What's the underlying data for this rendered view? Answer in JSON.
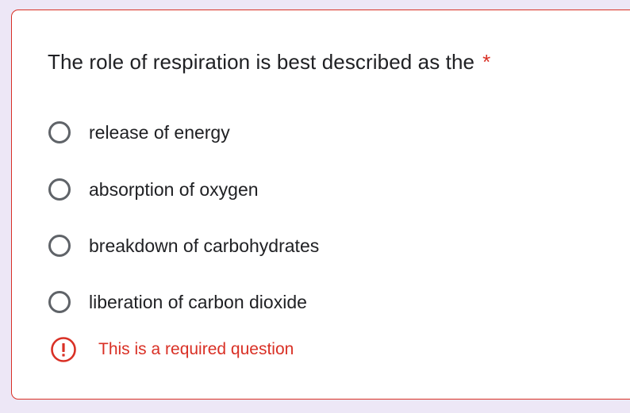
{
  "question": {
    "title": "The role of respiration is best described as the",
    "required_marker": "*",
    "options": [
      {
        "label": "release of energy",
        "selected": false
      },
      {
        "label": "absorption of oxygen",
        "selected": false
      },
      {
        "label": "breakdown of carbohydrates",
        "selected": false
      },
      {
        "label": "liberation of carbon dioxide",
        "selected": false
      }
    ],
    "error_message": "This is a required question"
  },
  "colors": {
    "error": "#d93025",
    "radio_border": "#5f6368",
    "text": "#202124",
    "background": "#ede7f6"
  },
  "icons": {
    "radio": "radio-unchecked-icon",
    "error": "error-alert-icon"
  }
}
